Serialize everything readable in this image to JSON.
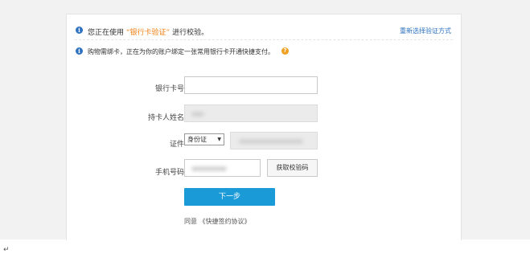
{
  "notice": {
    "prefix": "您正在使用",
    "method": "“银行卡验证”",
    "suffix": "进行校验。",
    "switch_link": "重新选择验证方式"
  },
  "tip": {
    "text": "购物需绑卡，正在为你的账户绑定一张常用银行卡开通快捷支付。"
  },
  "form": {
    "card_number_label": "银行卡号",
    "card_number_value": "",
    "holder_name_label": "持卡人姓名",
    "id_label": "证件",
    "id_type_selected": "身份证",
    "phone_label": "手机号码",
    "get_code_button": "获取校验码",
    "next_button": "下一步"
  },
  "agreement": {
    "prefix": "同意",
    "protocol_link": "《快捷签约协议》"
  },
  "footer": {
    "return_mark": "↵"
  },
  "colors": {
    "accent_blue": "#2f72c0",
    "button_blue": "#1b9ad8",
    "highlight_orange": "#f07f12"
  }
}
